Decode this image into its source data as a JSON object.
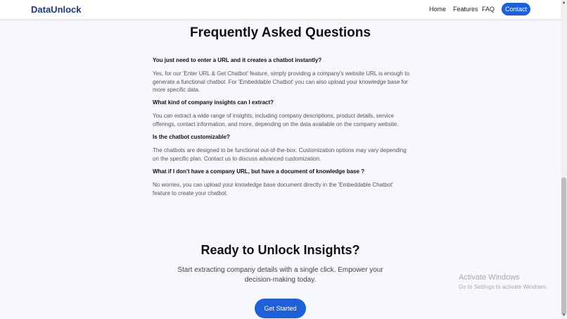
{
  "nav": {
    "logo": "DataUnlock",
    "links": [
      "Home",
      "Features",
      "FAQ"
    ],
    "contact": "Contact"
  },
  "faq": {
    "title": "Frequently Asked Questions",
    "items": [
      {
        "q": "You just need to enter a URL and it creates a chatbot instantly?",
        "a": "Yes, for our 'Enter URL & Get Chatbot' feature, simply providing a company's website URL is enough to generate a functional chatbot. For 'Embeddable Chatbot' you can also upload your knowledge base for more specific data."
      },
      {
        "q": "What kind of company insights can I extract?",
        "a": "You can extract a wide range of insights, including company descriptions, product details, service offerings, contact information, and more, depending on the data available on the company website."
      },
      {
        "q": "Is the chatbot customizable?",
        "a": "The chatbots are designed to be functional out-of-the-box. Customization options may vary depending on the specific plan. Contact us to discuss advanced customization."
      },
      {
        "q": "What if I don't have a company URL, but have a document of knowledge base ?",
        "a": "No worries, you can upload your knowledge base document directly in the 'Embeddable Chatbot' feature to create your chatbot."
      }
    ]
  },
  "cta": {
    "title": "Ready to Unlock Insights?",
    "subtitle": "Start extracting company details with a single click. Empower your decision-making today.",
    "button": "Get Started"
  },
  "watermark": {
    "title": "Activate Windows",
    "subtitle": "Go to Settings to activate Windows."
  },
  "scrollbar": {
    "up_icon": "arrow-up-icon",
    "down_icon": "arrow-down-icon"
  }
}
